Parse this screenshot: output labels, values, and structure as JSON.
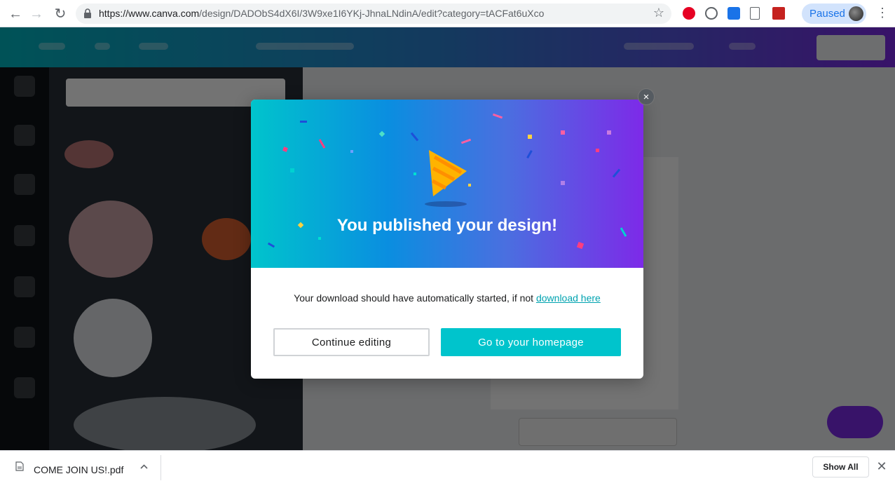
{
  "browser": {
    "url_main": "https://www.canva.com",
    "url_path": "/design/DADObS4dX6I/3W9xe1I6YKj-JhnaLNdinA/edit?category=tACFat6uXco",
    "profile_label": "Paused"
  },
  "modal": {
    "title": "You published your design!",
    "message": "Your download should have automatically started, if not ",
    "link_text": "download here",
    "continue_label": "Continue editing",
    "home_label": "Go to your homepage",
    "close_glyph": "×"
  },
  "downloads": {
    "file_name": "COME JOIN US!.pdf",
    "show_all_label": "Show All"
  },
  "colors": {
    "accent": "#00c4cc",
    "brand_purple": "#7d2ae8",
    "link": "#00a3b0"
  }
}
